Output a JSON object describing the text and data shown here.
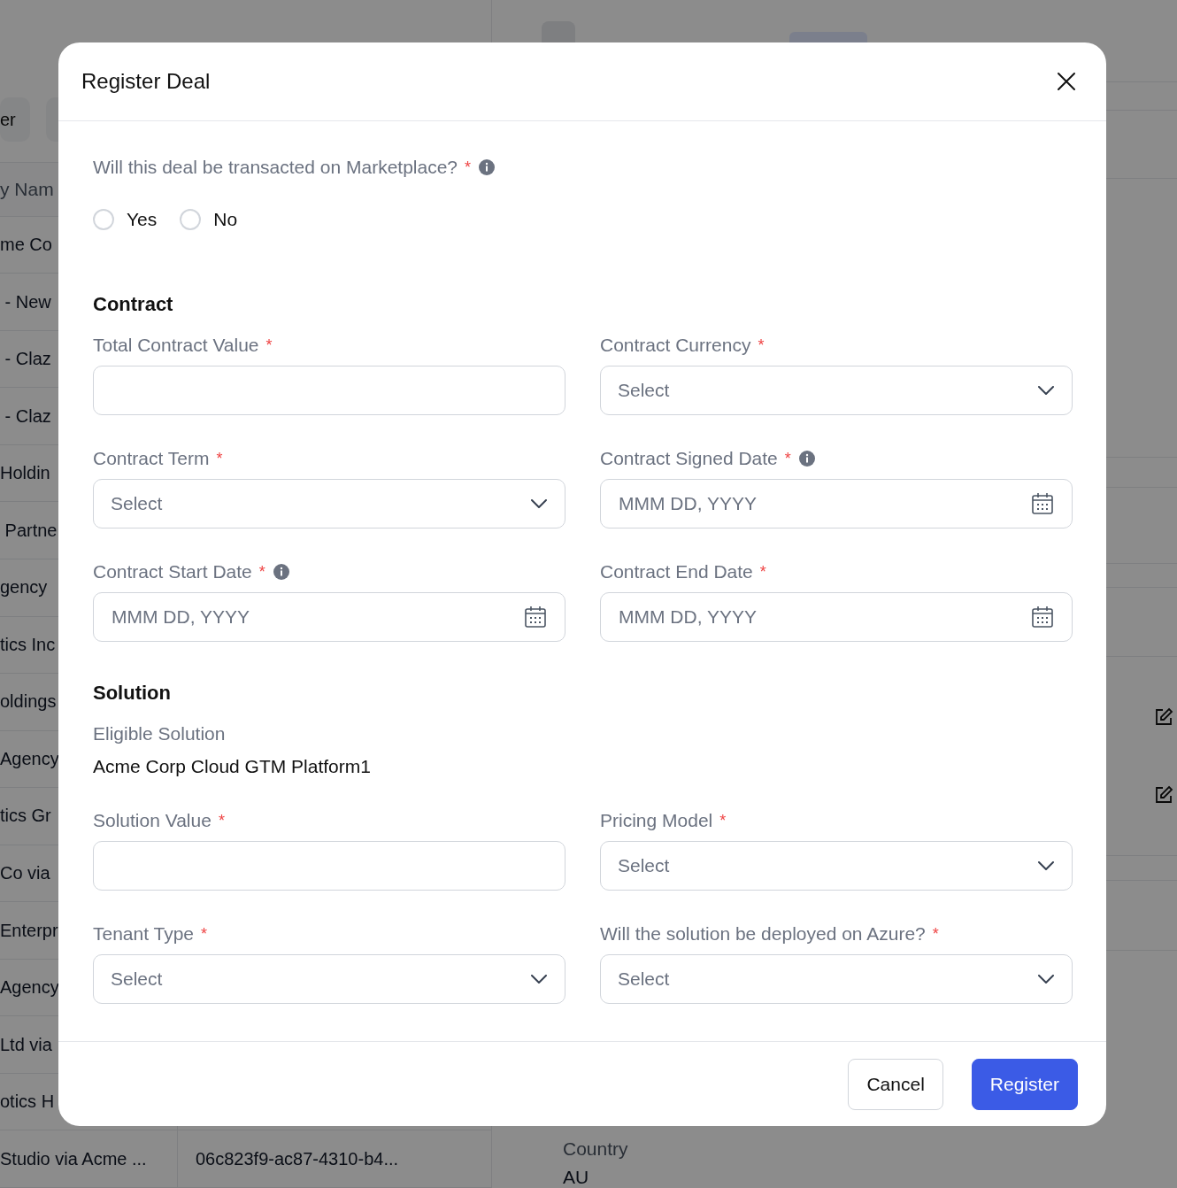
{
  "background": {
    "toolbar_button": "er",
    "table": {
      "header": "y Nam",
      "rows": [
        {
          "column_1": "me Co"
        },
        {
          "column_1": " - New"
        },
        {
          "column_1": " - Claz"
        },
        {
          "column_1": " - Claz"
        },
        {
          "column_1": "Holdin"
        },
        {
          "column_1": " Partne"
        },
        {
          "column_1": "gency"
        },
        {
          "column_1": "tics Inc"
        },
        {
          "column_1": "oldings"
        },
        {
          "column_1": "Agency"
        },
        {
          "column_1": "tics Gr"
        },
        {
          "column_1": "Co via"
        },
        {
          "column_1": "Enterpr"
        },
        {
          "column_1": "Agency"
        },
        {
          "column_1": "Ltd via"
        },
        {
          "column_1": "otics H"
        },
        {
          "column_1": "Studio via Acme ...",
          "column_2": "06c823f9-ac87-4310-b4..."
        }
      ]
    },
    "detail": {
      "fields": [
        {
          "label": "Country",
          "value": "AU"
        }
      ]
    }
  },
  "modal": {
    "title": "Register Deal",
    "question": {
      "text": "Will this deal be transacted on Marketplace?",
      "required_mark": "*",
      "info": true,
      "options": [
        {
          "label": "Yes",
          "selected": false
        },
        {
          "label": "No",
          "selected": false
        }
      ]
    },
    "sections": [
      {
        "title": "Contract",
        "fields": [
          {
            "label": "Total Contract Value",
            "required_mark": "*",
            "info": false,
            "kind": "text"
          },
          {
            "label": "Contract Currency",
            "required_mark": "*",
            "info": false,
            "kind": "select",
            "placeholder": "Select"
          },
          {
            "label": "Contract Term",
            "required_mark": "*",
            "info": false,
            "kind": "select",
            "placeholder": "Select"
          },
          {
            "label": "Contract Signed Date",
            "required_mark": "*",
            "info": true,
            "kind": "date",
            "placeholder": "MMM DD, YYYY"
          },
          {
            "label": "Contract Start Date",
            "required_mark": "*",
            "info": true,
            "kind": "date",
            "placeholder": "MMM DD, YYYY"
          },
          {
            "label": "Contract End Date",
            "required_mark": "*",
            "info": false,
            "kind": "date",
            "placeholder": "MMM DD, YYYY"
          }
        ]
      },
      {
        "title": "Solution",
        "static": {
          "label": "Eligible Solution",
          "value": "Acme Corp Cloud GTM Platform1"
        },
        "fields": [
          {
            "label": "Solution Value",
            "required_mark": "*",
            "info": false,
            "kind": "text"
          },
          {
            "label": "Pricing Model",
            "required_mark": "*",
            "info": false,
            "kind": "select",
            "placeholder": "Select"
          },
          {
            "label": "Tenant Type",
            "required_mark": "*",
            "info": false,
            "kind": "select",
            "placeholder": "Select"
          },
          {
            "label": "Will the solution be deployed on Azure?",
            "required_mark": "*",
            "info": false,
            "kind": "select",
            "placeholder": "Select"
          }
        ]
      }
    ],
    "buttons": [
      {
        "label": "Cancel",
        "kind": "secondary"
      },
      {
        "label": "Register",
        "kind": "primary"
      }
    ]
  }
}
